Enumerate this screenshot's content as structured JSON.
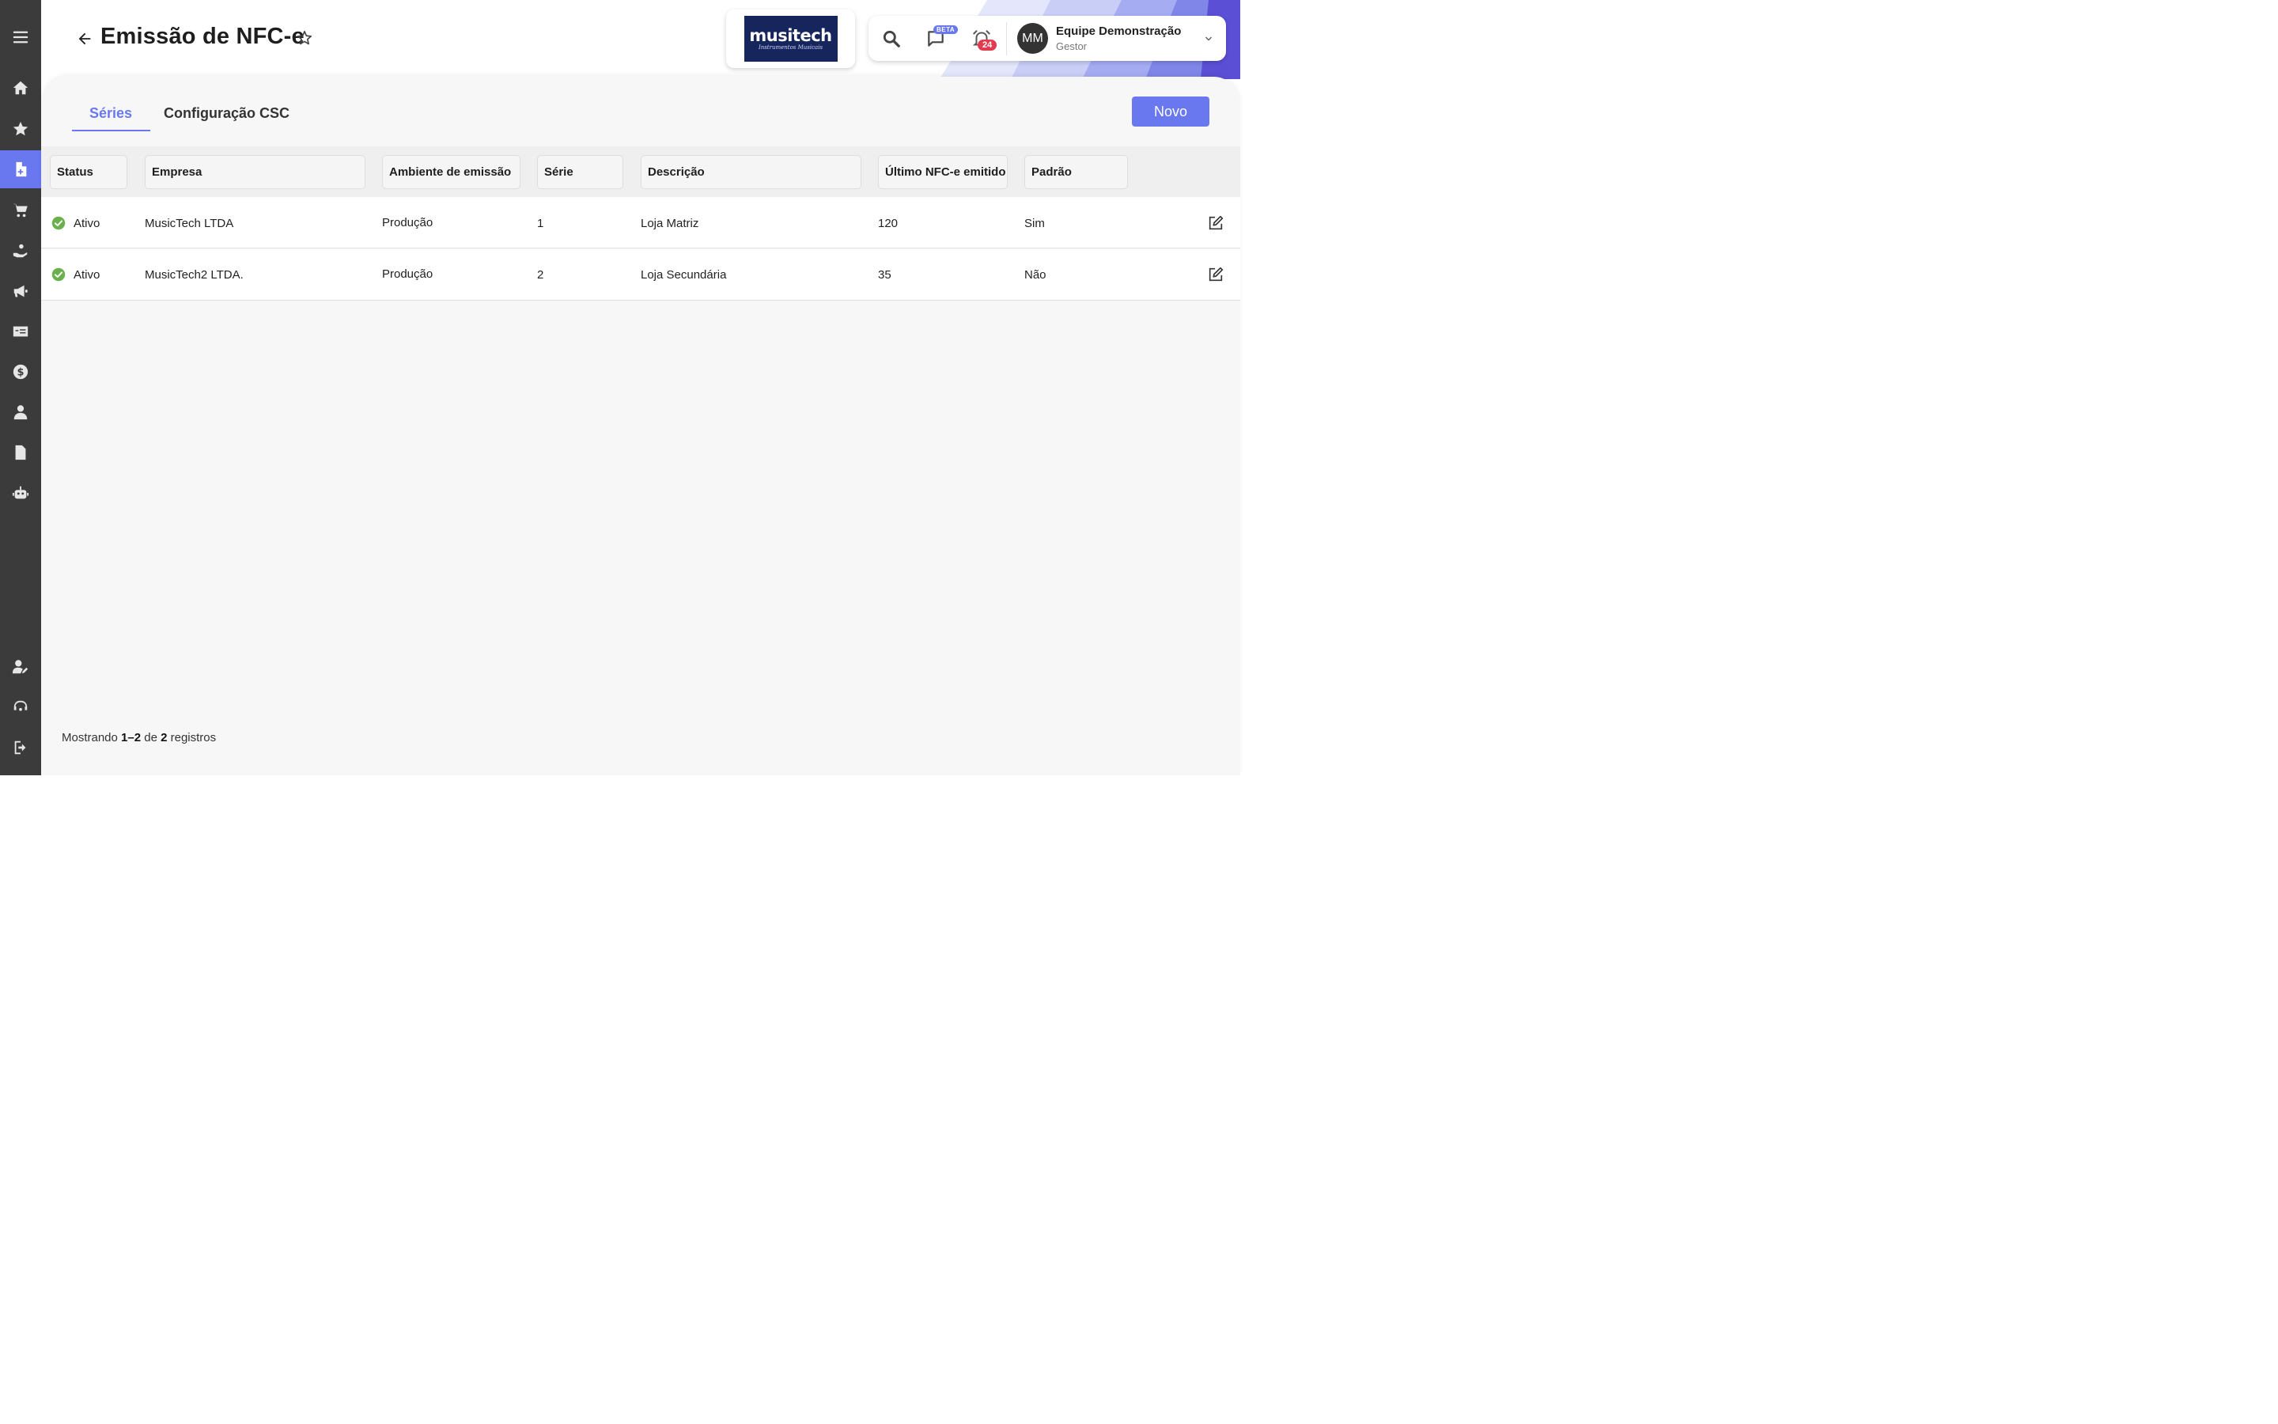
{
  "header": {
    "title": "Emissão de NFC-e",
    "logo_text": "musitech",
    "logo_subtext": "Instrumentos Musicais",
    "beta_label": "BETA",
    "notification_count": "24",
    "user": {
      "initials": "MM",
      "name": "Equipe Demonstração",
      "role": "Gestor"
    }
  },
  "sidebar": {
    "items": [
      {
        "icon": "menu-icon"
      },
      {
        "icon": "home-icon"
      },
      {
        "icon": "star-icon"
      },
      {
        "icon": "document-add-icon",
        "active": true
      },
      {
        "icon": "cart-icon"
      },
      {
        "icon": "hand-coins-icon"
      },
      {
        "icon": "megaphone-icon"
      },
      {
        "icon": "money-card-icon"
      },
      {
        "icon": "dollar-icon"
      },
      {
        "icon": "user-tie-icon"
      },
      {
        "icon": "file-icon"
      },
      {
        "icon": "robot-icon"
      },
      {
        "icon": "user-edit-icon"
      },
      {
        "icon": "support-icon"
      },
      {
        "icon": "logout-icon"
      }
    ]
  },
  "tabs": [
    {
      "label": "Séries",
      "active": true
    },
    {
      "label": "Configuração CSC",
      "active": false
    }
  ],
  "new_button": "Novo",
  "table": {
    "columns": [
      "Status",
      "Empresa",
      "Ambiente de emissão",
      "Série",
      "Descrição",
      "Último NFC-e emitido",
      "Padrão"
    ],
    "rows": [
      {
        "status": "Ativo",
        "empresa": "MusicTech LTDA",
        "ambiente": "Produção",
        "serie": "1",
        "descricao": "Loja Matriz",
        "ultimo": "120",
        "padrao": "Sim"
      },
      {
        "status": "Ativo",
        "empresa": "MusicTech2 LTDA.",
        "ambiente": "Produção",
        "serie": "2",
        "descricao": "Loja Secundária",
        "ultimo": "35",
        "padrao": "Não"
      }
    ]
  },
  "footer": {
    "prefix": "Mostrando",
    "range": "1–2",
    "of": "de",
    "total": "2",
    "suffix": "registros"
  },
  "colors": {
    "accent": "#6a78f0",
    "sidebar": "#3b3b3b",
    "success": "#6ab04c",
    "danger": "#e23b4f"
  }
}
